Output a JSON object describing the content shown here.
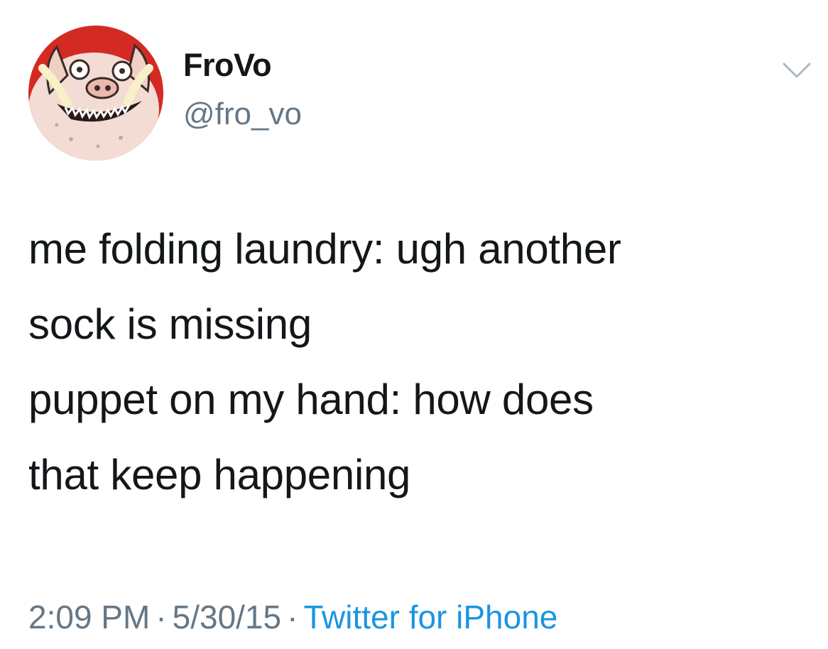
{
  "user": {
    "display_name": "FroVo",
    "handle": "@fro_vo",
    "avatar_icon": "pig-puppet-avatar"
  },
  "tweet": {
    "text_lines": [
      "me folding laundry: ugh another",
      "sock is missing",
      "puppet on my hand: how does",
      "that keep happening"
    ]
  },
  "meta": {
    "time": "2:09 PM",
    "separator": "·",
    "date": "5/30/15",
    "source": "Twitter for iPhone"
  },
  "colors": {
    "text": "#14171a",
    "secondary": "#657786",
    "link": "#1b95e0",
    "avatar_bg": "#d42a24"
  },
  "icons": {
    "menu": "chevron-down-icon"
  }
}
